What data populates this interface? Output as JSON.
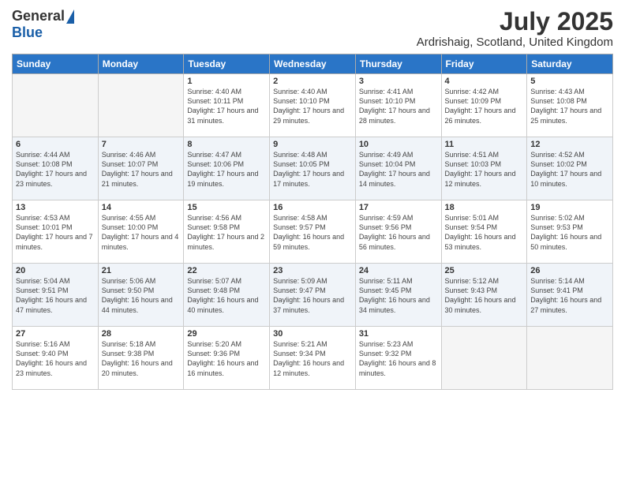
{
  "header": {
    "logo_general": "General",
    "logo_blue": "Blue",
    "month_title": "July 2025",
    "location": "Ardrishaig, Scotland, United Kingdom"
  },
  "days_of_week": [
    "Sunday",
    "Monday",
    "Tuesday",
    "Wednesday",
    "Thursday",
    "Friday",
    "Saturday"
  ],
  "weeks": [
    [
      {
        "day": "",
        "info": "",
        "empty": true
      },
      {
        "day": "",
        "info": "",
        "empty": true
      },
      {
        "day": "1",
        "info": "Sunrise: 4:40 AM\nSunset: 10:11 PM\nDaylight: 17 hours and 31 minutes."
      },
      {
        "day": "2",
        "info": "Sunrise: 4:40 AM\nSunset: 10:10 PM\nDaylight: 17 hours and 29 minutes."
      },
      {
        "day": "3",
        "info": "Sunrise: 4:41 AM\nSunset: 10:10 PM\nDaylight: 17 hours and 28 minutes."
      },
      {
        "day": "4",
        "info": "Sunrise: 4:42 AM\nSunset: 10:09 PM\nDaylight: 17 hours and 26 minutes."
      },
      {
        "day": "5",
        "info": "Sunrise: 4:43 AM\nSunset: 10:08 PM\nDaylight: 17 hours and 25 minutes."
      }
    ],
    [
      {
        "day": "6",
        "info": "Sunrise: 4:44 AM\nSunset: 10:08 PM\nDaylight: 17 hours and 23 minutes."
      },
      {
        "day": "7",
        "info": "Sunrise: 4:46 AM\nSunset: 10:07 PM\nDaylight: 17 hours and 21 minutes."
      },
      {
        "day": "8",
        "info": "Sunrise: 4:47 AM\nSunset: 10:06 PM\nDaylight: 17 hours and 19 minutes."
      },
      {
        "day": "9",
        "info": "Sunrise: 4:48 AM\nSunset: 10:05 PM\nDaylight: 17 hours and 17 minutes."
      },
      {
        "day": "10",
        "info": "Sunrise: 4:49 AM\nSunset: 10:04 PM\nDaylight: 17 hours and 14 minutes."
      },
      {
        "day": "11",
        "info": "Sunrise: 4:51 AM\nSunset: 10:03 PM\nDaylight: 17 hours and 12 minutes."
      },
      {
        "day": "12",
        "info": "Sunrise: 4:52 AM\nSunset: 10:02 PM\nDaylight: 17 hours and 10 minutes."
      }
    ],
    [
      {
        "day": "13",
        "info": "Sunrise: 4:53 AM\nSunset: 10:01 PM\nDaylight: 17 hours and 7 minutes."
      },
      {
        "day": "14",
        "info": "Sunrise: 4:55 AM\nSunset: 10:00 PM\nDaylight: 17 hours and 4 minutes."
      },
      {
        "day": "15",
        "info": "Sunrise: 4:56 AM\nSunset: 9:58 PM\nDaylight: 17 hours and 2 minutes."
      },
      {
        "day": "16",
        "info": "Sunrise: 4:58 AM\nSunset: 9:57 PM\nDaylight: 16 hours and 59 minutes."
      },
      {
        "day": "17",
        "info": "Sunrise: 4:59 AM\nSunset: 9:56 PM\nDaylight: 16 hours and 56 minutes."
      },
      {
        "day": "18",
        "info": "Sunrise: 5:01 AM\nSunset: 9:54 PM\nDaylight: 16 hours and 53 minutes."
      },
      {
        "day": "19",
        "info": "Sunrise: 5:02 AM\nSunset: 9:53 PM\nDaylight: 16 hours and 50 minutes."
      }
    ],
    [
      {
        "day": "20",
        "info": "Sunrise: 5:04 AM\nSunset: 9:51 PM\nDaylight: 16 hours and 47 minutes."
      },
      {
        "day": "21",
        "info": "Sunrise: 5:06 AM\nSunset: 9:50 PM\nDaylight: 16 hours and 44 minutes."
      },
      {
        "day": "22",
        "info": "Sunrise: 5:07 AM\nSunset: 9:48 PM\nDaylight: 16 hours and 40 minutes."
      },
      {
        "day": "23",
        "info": "Sunrise: 5:09 AM\nSunset: 9:47 PM\nDaylight: 16 hours and 37 minutes."
      },
      {
        "day": "24",
        "info": "Sunrise: 5:11 AM\nSunset: 9:45 PM\nDaylight: 16 hours and 34 minutes."
      },
      {
        "day": "25",
        "info": "Sunrise: 5:12 AM\nSunset: 9:43 PM\nDaylight: 16 hours and 30 minutes."
      },
      {
        "day": "26",
        "info": "Sunrise: 5:14 AM\nSunset: 9:41 PM\nDaylight: 16 hours and 27 minutes."
      }
    ],
    [
      {
        "day": "27",
        "info": "Sunrise: 5:16 AM\nSunset: 9:40 PM\nDaylight: 16 hours and 23 minutes."
      },
      {
        "day": "28",
        "info": "Sunrise: 5:18 AM\nSunset: 9:38 PM\nDaylight: 16 hours and 20 minutes."
      },
      {
        "day": "29",
        "info": "Sunrise: 5:20 AM\nSunset: 9:36 PM\nDaylight: 16 hours and 16 minutes."
      },
      {
        "day": "30",
        "info": "Sunrise: 5:21 AM\nSunset: 9:34 PM\nDaylight: 16 hours and 12 minutes."
      },
      {
        "day": "31",
        "info": "Sunrise: 5:23 AM\nSunset: 9:32 PM\nDaylight: 16 hours and 8 minutes."
      },
      {
        "day": "",
        "info": "",
        "empty": true
      },
      {
        "day": "",
        "info": "",
        "empty": true
      }
    ]
  ]
}
